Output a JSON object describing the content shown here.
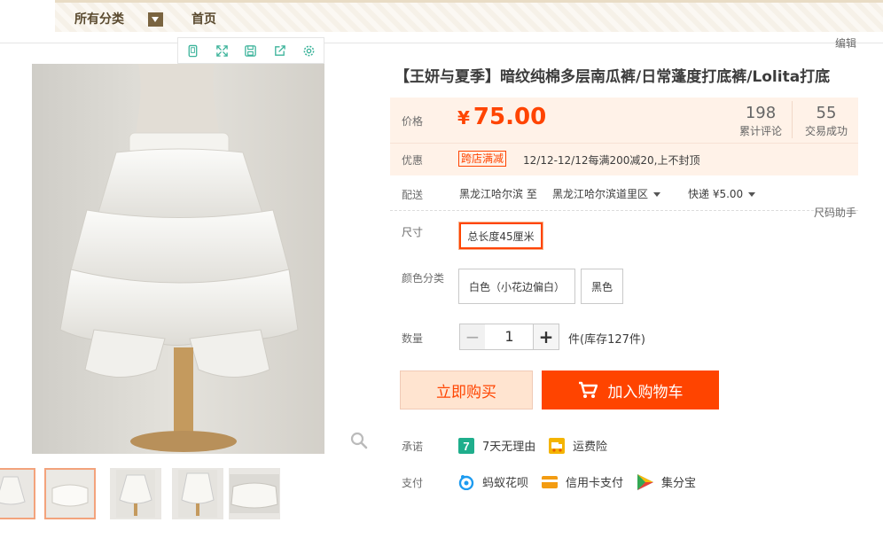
{
  "nav": {
    "all_categories": "所有分类",
    "home": "首页",
    "edit": "编辑"
  },
  "product": {
    "title": "【王妍与夏季】暗纹纯棉多层南瓜裤/日常蓬度打底裤/Lolita打底",
    "price_label": "价格",
    "currency": "¥",
    "price": "75.00",
    "reviews_count": "198",
    "reviews_label": "累计评论",
    "sales_count": "55",
    "sales_label": "交易成功",
    "promo_label": "优惠",
    "promo_tag": "跨店满减",
    "promo_text": "12/12-12/12每满200减20,上不封顶",
    "shipping_label": "配送",
    "ship_from": "黑龙江哈尔滨 至",
    "ship_to": "黑龙江哈尔滨道里区",
    "ship_cost": "快递 ¥5.00",
    "size_helper": "尺码助手",
    "size_label": "尺寸",
    "size_option": "总长度45厘米",
    "color_label": "颜色分类",
    "color_options": [
      "白色（小花边偏白）",
      "黑色"
    ],
    "qty_label": "数量",
    "qty_value": "1",
    "stock_text": "件(库存127件)",
    "buy_now": "立即购买",
    "add_to_cart": "加入购物车",
    "promise_label": "承诺",
    "promise_items": [
      "7天无理由",
      "运费险"
    ],
    "payment_label": "支付",
    "payment_items": [
      "蚂蚁花呗",
      "信用卡支付",
      "集分宝"
    ]
  },
  "colors": {
    "accent": "#ff4400",
    "price_bg": "#fff2e8",
    "buy_now_bg": "#ffe4d0",
    "tool_icon": "#3bb39a"
  },
  "icons": {
    "toolbar": [
      "phone-icon",
      "fullscreen-icon",
      "save-icon",
      "share-icon",
      "settings-icon"
    ],
    "zoom": "magnifier-icon",
    "cart": "cart-icon"
  }
}
